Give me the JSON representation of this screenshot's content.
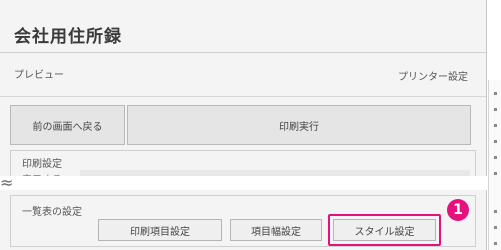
{
  "header": {
    "title": "会社用住所録"
  },
  "toolbar": {
    "preview_label": "プレビュー",
    "printer_settings_label": "プリンター設定"
  },
  "actions": {
    "back_label": "前の画面へ戻る",
    "print_label": "印刷実行"
  },
  "print_settings": {
    "section_label": "印刷設定",
    "row_label": "表示する"
  },
  "list_settings": {
    "section_label": "一覧表の設定",
    "buttons": [
      {
        "label": "印刷項目設定"
      },
      {
        "label": "項目幅設定"
      },
      {
        "label": "スタイル設定"
      }
    ]
  },
  "callout": {
    "number": "1",
    "color": "#e5127d"
  }
}
